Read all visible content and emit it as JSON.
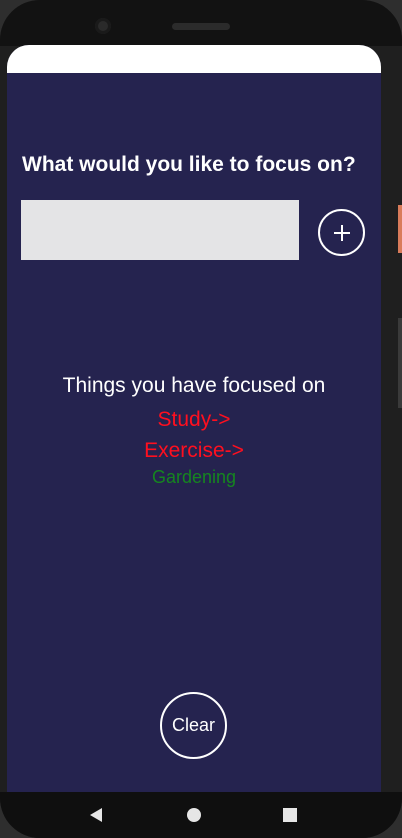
{
  "prompt": {
    "title": "What would you like to focus on?"
  },
  "input": {
    "value": "",
    "placeholder": ""
  },
  "add_button": {
    "icon": "plus-icon"
  },
  "history": {
    "heading": "Things you have focused on",
    "items": [
      {
        "label": "Study->",
        "status": "pending"
      },
      {
        "label": "Exercise->",
        "status": "pending"
      },
      {
        "label": "Gardening",
        "status": "done"
      }
    ]
  },
  "clear_button": {
    "label": "Clear"
  },
  "navigation": {
    "back_icon": "back-triangle-icon",
    "home_icon": "home-circle-icon",
    "recents_icon": "recents-square-icon"
  },
  "colors": {
    "background": "#25234f",
    "pending_item": "#ff0f1f",
    "done_item": "#15861f",
    "input_background": "#e4e4e6"
  }
}
